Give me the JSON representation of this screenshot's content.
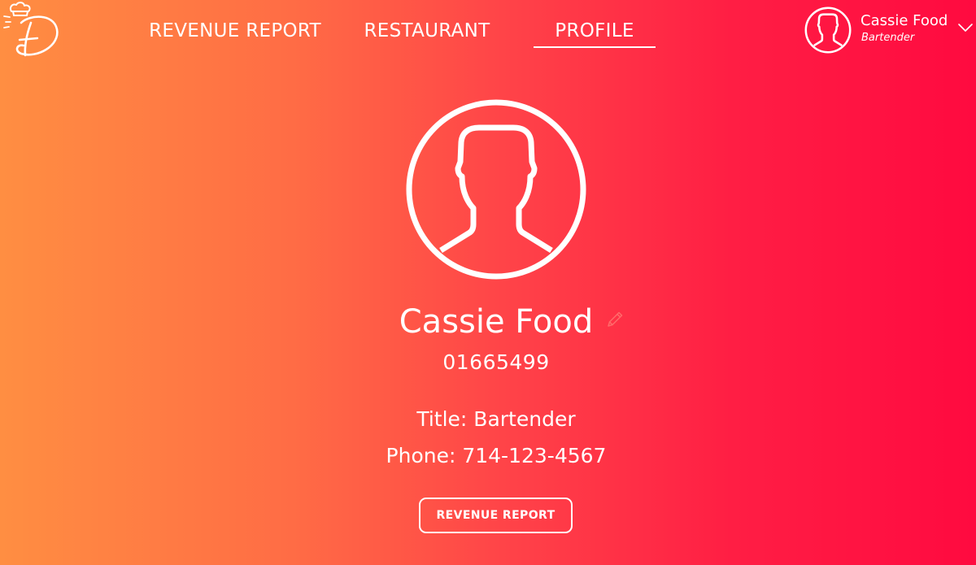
{
  "nav": {
    "tabs": [
      {
        "label": "REVENUE REPORT"
      },
      {
        "label": "RESTAURANT"
      },
      {
        "label": "PROFILE",
        "active": true
      }
    ]
  },
  "user_menu": {
    "name": "Cassie Food",
    "role": "Bartender",
    "icons": {
      "avatar": "user-silhouette-icon",
      "toggle": "chevron-down-icon"
    }
  },
  "logo": {
    "icon": "chef-hat-logo-icon"
  },
  "profile": {
    "name": "Cassie Food",
    "id": "01665499",
    "title_line": "Title: Bartender",
    "phone_line": "Phone: 714-123-4567",
    "edit_icon": "pencil-icon",
    "button_label": "REVENUE REPORT"
  },
  "colors": {
    "gradient_start": "#ff8e42",
    "gradient_end": "#ff0a40",
    "foreground": "#ffffff",
    "edit_icon": "#ff6a6a"
  }
}
